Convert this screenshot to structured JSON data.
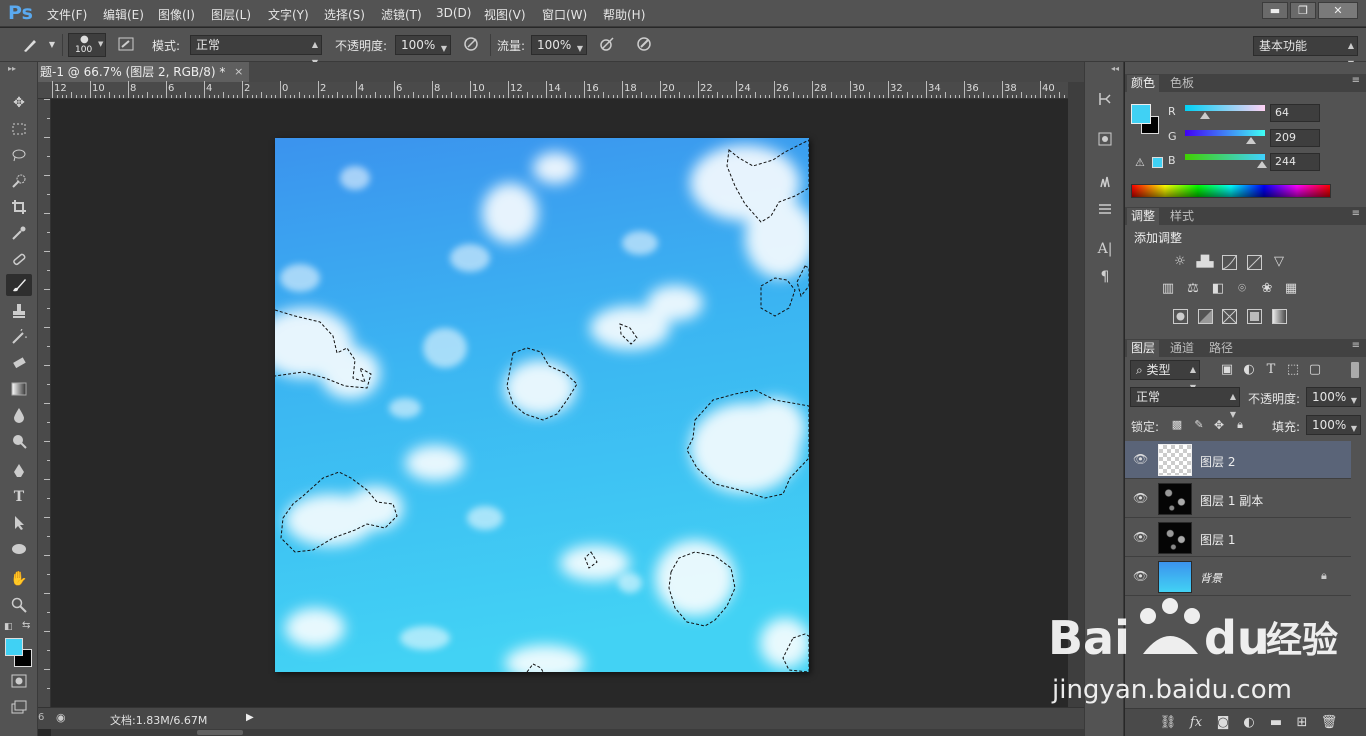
{
  "app": {
    "logo": "Ps"
  },
  "menu": [
    "文件(F)",
    "编辑(E)",
    "图像(I)",
    "图层(L)",
    "文字(Y)",
    "选择(S)",
    "滤镜(T)",
    "3D(D)",
    "视图(V)",
    "窗口(W)",
    "帮助(H)"
  ],
  "window_buttons": {
    "minimize": "▬",
    "restore": "❐",
    "close": "✕"
  },
  "options": {
    "brush_size": "100",
    "mode_label": "模式:",
    "mode_value": "正常",
    "opacity_label": "不透明度:",
    "opacity_value": "100%",
    "flow_label": "流量:",
    "flow_value": "100%",
    "workspace": "基本功能"
  },
  "document": {
    "tab_title": "题-1 @ 66.7% (图层 2, RGB/8) *",
    "close": "×",
    "status": "文档:1.83M/6.67M",
    "ruler_h": [
      "12",
      "10",
      "8",
      "6",
      "4",
      "2",
      "0",
      "2",
      "4",
      "6",
      "8",
      "10",
      "12",
      "14",
      "16",
      "18",
      "20",
      "22",
      "24",
      "26",
      "28",
      "30",
      "32",
      "34",
      "36",
      "38",
      "40"
    ]
  },
  "color_panel": {
    "tabs": [
      "颜色",
      "色板"
    ],
    "foreground": "#40d1f4",
    "background": "#000000",
    "r_label": "R",
    "g_label": "G",
    "b_label": "B",
    "r": "64",
    "g": "209",
    "b": "244",
    "r_level": 0.25,
    "g_level": 0.82,
    "b_level": 0.96
  },
  "adjust_panel": {
    "tabs": [
      "调整",
      "样式"
    ],
    "title": "添加调整",
    "icons": [
      "brightness-icon",
      "levels-icon",
      "curves-icon",
      "exposure-icon",
      "vibrance-icon",
      "hue-saturation-icon",
      "color-balance-icon",
      "black-white-icon",
      "photo-filter-icon",
      "channel-mixer-icon",
      "color-lookup-icon",
      "invert-icon",
      "posterize-icon",
      "threshold-icon",
      "selective-color-icon",
      "gradient-map-icon"
    ]
  },
  "layers_panel": {
    "tabs": [
      "图层",
      "通道",
      "路径"
    ],
    "filter_kind": "类型",
    "blend_mode": "正常",
    "opacity_label": "不透明度:",
    "opacity_value": "100%",
    "lock_label": "锁定:",
    "fill_label": "填充:",
    "fill_value": "100%",
    "layers": [
      {
        "name": "图层 2",
        "selected": true
      },
      {
        "name": "图层 1 副本",
        "selected": false
      },
      {
        "name": "图层 1",
        "selected": false
      },
      {
        "name": "背景",
        "selected": false
      }
    ]
  }
}
